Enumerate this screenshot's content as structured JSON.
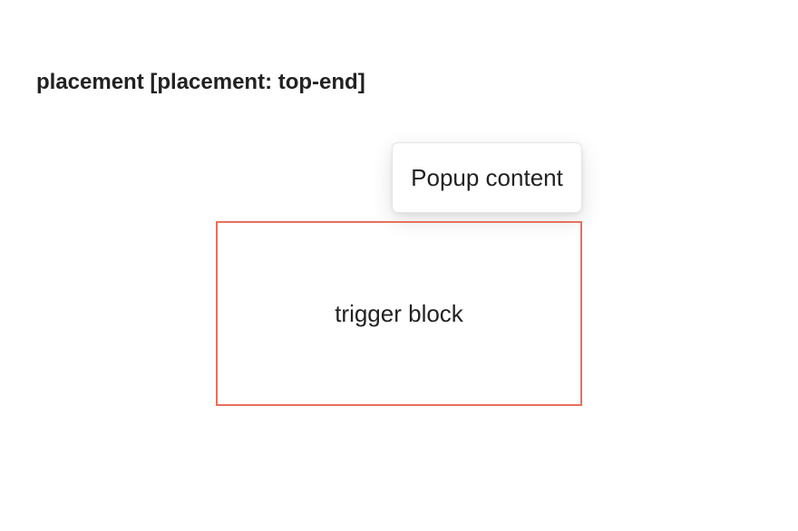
{
  "page": {
    "title": "placement [placement: top-end]"
  },
  "popup": {
    "content": "Popup content",
    "placement": "top-end"
  },
  "trigger": {
    "label": "trigger block",
    "border_color": "#e8705c"
  }
}
